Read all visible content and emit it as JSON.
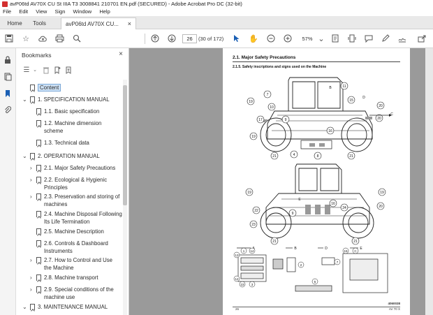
{
  "window": {
    "title": "avP06td AV70X CU St IIIA T3 3008841 210701 EN.pdf (SECURED) - Adobe Acrobat Pro DC (32-bit)"
  },
  "menu": [
    "File",
    "Edit",
    "View",
    "Sign",
    "Window",
    "Help"
  ],
  "tabs": {
    "home": "Home",
    "tools": "Tools",
    "document": "avP06td AV70X CU...",
    "close": "×"
  },
  "toolbar": {
    "page_current": "26",
    "page_count": "(30 of 172)",
    "zoom": "57%"
  },
  "bookmarks": {
    "title": "Bookmarks",
    "close": "×",
    "items": [
      {
        "label": "Content",
        "level": 0,
        "chevron": "",
        "selected": true
      },
      {
        "label": "1. SPECIFICATION MANUAL",
        "level": 0,
        "chevron": "⌄"
      },
      {
        "label": "1.1. Basic specification",
        "level": 1,
        "chevron": ""
      },
      {
        "label": "1.2. Machine dimension scheme",
        "level": 1,
        "chevron": ""
      },
      {
        "label": "1.3. Technical data",
        "level": 1,
        "chevron": ""
      },
      {
        "label": "2. OPERATION MANUAL",
        "level": 0,
        "chevron": "⌄"
      },
      {
        "label": "2.1. Major Safety Precautions",
        "level": 1,
        "chevron": "›"
      },
      {
        "label": "2.2. Ecological & Hygienic Principles",
        "level": 1,
        "chevron": "›"
      },
      {
        "label": "2.3. Preservation and storing of machines",
        "level": 1,
        "chevron": "›"
      },
      {
        "label": "2.4. Machine Disposal Following Its Life Termination",
        "level": 1,
        "chevron": ""
      },
      {
        "label": "2.5. Machine Description",
        "level": 1,
        "chevron": ""
      },
      {
        "label": "2.6. Controls & Dashboard Instruments",
        "level": 1,
        "chevron": ""
      },
      {
        "label": "2.7. How to Control and Use the Machine",
        "level": 1,
        "chevron": "›"
      },
      {
        "label": "2.8. Machine transport",
        "level": 1,
        "chevron": "›"
      },
      {
        "label": "2.9. Special conditions of the machine use",
        "level": 1,
        "chevron": "›"
      },
      {
        "label": "3. MAINTENANCE MANUAL",
        "level": 0,
        "chevron": "⌄"
      }
    ]
  },
  "page": {
    "section_title": "2.1.    Major Safety Precautions",
    "subsection_title": "2.1.5.   Safety inscriptions and signs used on the Machine",
    "page_number": "26",
    "footer_code": "AV 70 X",
    "diagram_id": "4060038",
    "callouts_top": [
      "19",
      "7",
      "10",
      "9",
      "15",
      "18",
      "B",
      "11",
      "D",
      "20",
      "C",
      "19",
      "20",
      "17",
      "16",
      "4",
      "8",
      "21",
      "21"
    ],
    "callouts_bottom": [
      "19",
      "19",
      "22",
      "E",
      "16",
      "24",
      "20",
      "23",
      "9",
      "21",
      "21",
      "A",
      "B",
      "D",
      "E",
      "13",
      "1",
      "14",
      "2",
      "12",
      "23",
      "3",
      "15",
      "C",
      "5"
    ]
  }
}
